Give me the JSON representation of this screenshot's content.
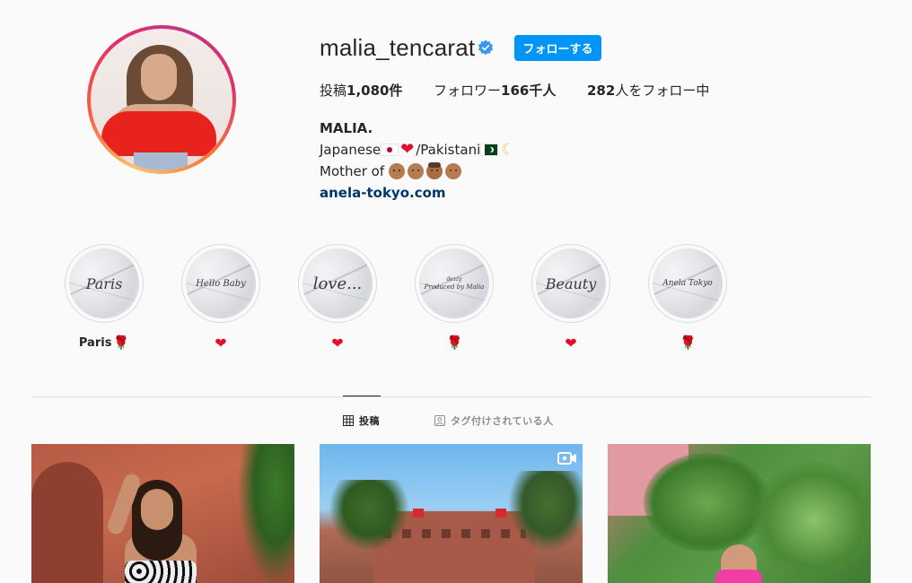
{
  "profile": {
    "username": "malia_tencarat",
    "follow_button": "フォローする",
    "stats": {
      "posts_label": "投稿",
      "posts_count": "1,080件",
      "followers_label": "フォロワー",
      "followers_count": "166千人",
      "following_count": "282",
      "following_label": "人をフォロー中"
    },
    "bio": {
      "name": "MALIA.",
      "line1_a": "Japanese",
      "line1_b": "/Pakistani",
      "line2": "Mother of",
      "link": "anela-tokyo.com"
    }
  },
  "highlights": [
    {
      "cover_text": "Paris",
      "label": "Paris"
    },
    {
      "cover_text": "Hello Baby",
      "label": ""
    },
    {
      "cover_text": "love...",
      "label": ""
    },
    {
      "cover_text": "Produced by Malia",
      "cover_small": "dezzy",
      "label": ""
    },
    {
      "cover_text": "Beauty",
      "label": ""
    },
    {
      "cover_text": "Anela Tokyo",
      "label": ""
    }
  ],
  "tabs": {
    "posts": "投稿",
    "tagged": "タグ付けされている人"
  },
  "colors": {
    "follow_blue": "#0095f6",
    "link_blue": "#00376b",
    "verified_blue": "#3897f0",
    "background": "#fafafa"
  },
  "icons": {
    "verified": "verified-badge-icon",
    "posts_tab": "grid-icon",
    "tagged_tab": "tagged-user-icon",
    "video": "video-camera-icon"
  }
}
